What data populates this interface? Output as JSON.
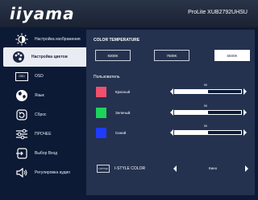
{
  "header": {
    "logo": "iiyama",
    "model": "ProLite XUB2792UHSU"
  },
  "sidebar": {
    "items": [
      {
        "label": "Настройка изображения",
        "icon": "brightness-icon"
      },
      {
        "label": "Настройка цветов",
        "icon": "palette-icon"
      },
      {
        "label": "OSD",
        "icon": "osd-icon",
        "icon_text": "OSD"
      },
      {
        "label": "Язык",
        "icon": "globe-icon"
      },
      {
        "label": "Сброс",
        "icon": "reset-icon"
      },
      {
        "label": "ПРОЧЕЕ",
        "icon": "sliders-icon"
      },
      {
        "label": "Выбор Вход",
        "icon": "input-icon"
      },
      {
        "label": "Регулировка аудио",
        "icon": "speaker-icon"
      }
    ]
  },
  "main": {
    "color_temperature": {
      "title": "COLOR TEMPERATURE",
      "options": [
        "9300K",
        "7500K",
        "6500K"
      ],
      "selected": "6500K"
    },
    "user": {
      "title": "Пользователь",
      "rows": [
        {
          "label": "Красный",
          "value": "50",
          "level": 0.5,
          "color": "#f0506e"
        },
        {
          "label": "Зеленый",
          "value": "50",
          "level": 0.5,
          "color": "#1ed35a"
        },
        {
          "label": "Синий",
          "value": "50",
          "level": 0.5,
          "color": "#1f3bff"
        }
      ]
    },
    "istyle": {
      "icon_text": "I-STYLE",
      "label": "I-STYLE COLOR",
      "value": "Кино"
    }
  },
  "colors": {
    "panel": "#24324f",
    "background": "#0c1a35",
    "highlight": "#e9edf3"
  }
}
